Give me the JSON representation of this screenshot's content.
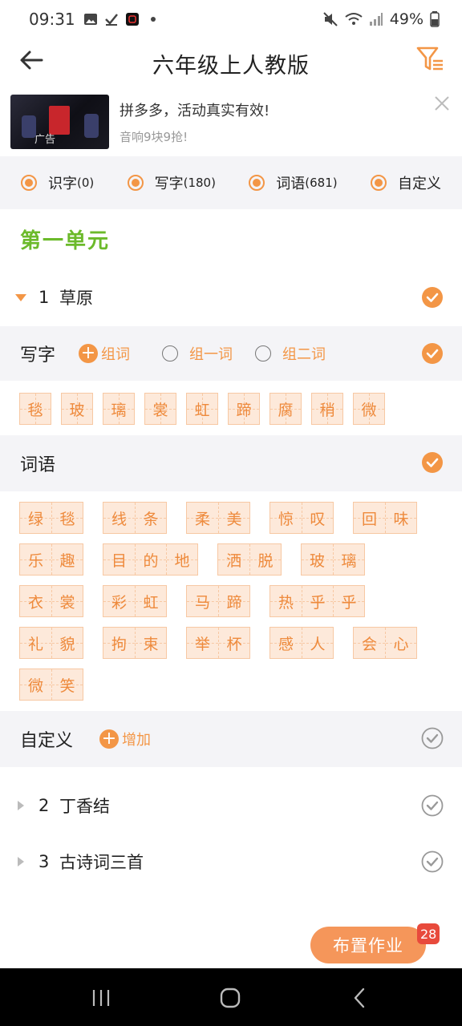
{
  "status": {
    "time": "09:31",
    "battery": "49%"
  },
  "header": {
    "title": "六年级上人教版"
  },
  "ad": {
    "title": "拼多多，活动真实有效!",
    "subtitle": "音响9块9抢!",
    "tag": "广告"
  },
  "types": [
    {
      "label": "识字",
      "count": "(0)"
    },
    {
      "label": "写字",
      "count": "(180)"
    },
    {
      "label": "词语",
      "count": "(681)"
    },
    {
      "label": "自定义",
      "count": ""
    }
  ],
  "unit": {
    "title": "第一单元"
  },
  "lessons": [
    {
      "num": "1",
      "name": "草原"
    },
    {
      "num": "2",
      "name": "丁香结"
    },
    {
      "num": "3",
      "name": "古诗词三首"
    }
  ],
  "writing": {
    "label": "写字",
    "add_word": "组词",
    "option1": "组一词",
    "option2": "组二词",
    "chars": [
      "毯",
      "玻",
      "璃",
      "裳",
      "虹",
      "蹄",
      "腐",
      "稍",
      "微"
    ]
  },
  "vocab": {
    "label": "词语",
    "rows": [
      [
        [
          "绿",
          "毯"
        ],
        [
          "线",
          "条"
        ],
        [
          "柔",
          "美"
        ],
        [
          "惊",
          "叹"
        ],
        [
          "回",
          "味"
        ]
      ],
      [
        [
          "乐",
          "趣"
        ],
        [
          "目",
          "的",
          "地"
        ],
        [
          "洒",
          "脱"
        ],
        [
          "玻",
          "璃"
        ]
      ],
      [
        [
          "衣",
          "裳"
        ],
        [
          "彩",
          "虹"
        ],
        [
          "马",
          "蹄"
        ],
        [
          "热",
          "乎",
          "乎"
        ]
      ],
      [
        [
          "礼",
          "貌"
        ],
        [
          "拘",
          "束"
        ],
        [
          "举",
          "杯"
        ],
        [
          "感",
          "人"
        ],
        [
          "会",
          "心"
        ]
      ],
      [
        [
          "微",
          "笑"
        ]
      ]
    ]
  },
  "custom": {
    "label": "自定义",
    "add": "增加"
  },
  "assign": {
    "label": "布置作业",
    "badge": "28"
  },
  "colors": {
    "accent": "#f39646",
    "unit_green": "#6cba2b",
    "badge_red": "#e84a3c"
  }
}
